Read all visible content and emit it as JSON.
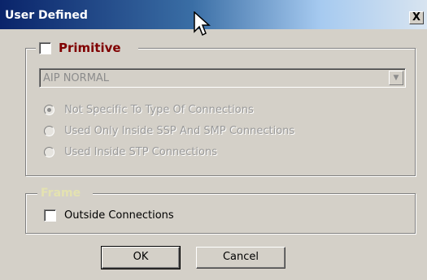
{
  "window": {
    "title": "User Defined",
    "close_label": "X"
  },
  "primitive": {
    "label": "Primitive",
    "checked": false,
    "select": {
      "value": "AIP NORMAL",
      "enabled": false
    },
    "radios": [
      {
        "label": "Not Specific To Type Of Connections",
        "selected": true
      },
      {
        "label": "Used Only Inside SSP And SMP Connections",
        "selected": false
      },
      {
        "label": "Used Inside STP Connections",
        "selected": false
      }
    ]
  },
  "frame": {
    "label": "Frame",
    "outside_connections": {
      "label": "Outside Connections",
      "checked": false
    }
  },
  "buttons": {
    "ok": "OK",
    "cancel": "Cancel"
  },
  "colors": {
    "title_start": "#0a246a",
    "title_end": "#d8e4f0",
    "face": "#d4d0c8",
    "primitive_label": "#800000",
    "disabled_text": "#9a9a9a",
    "frame_label": "#e4e2b0"
  }
}
